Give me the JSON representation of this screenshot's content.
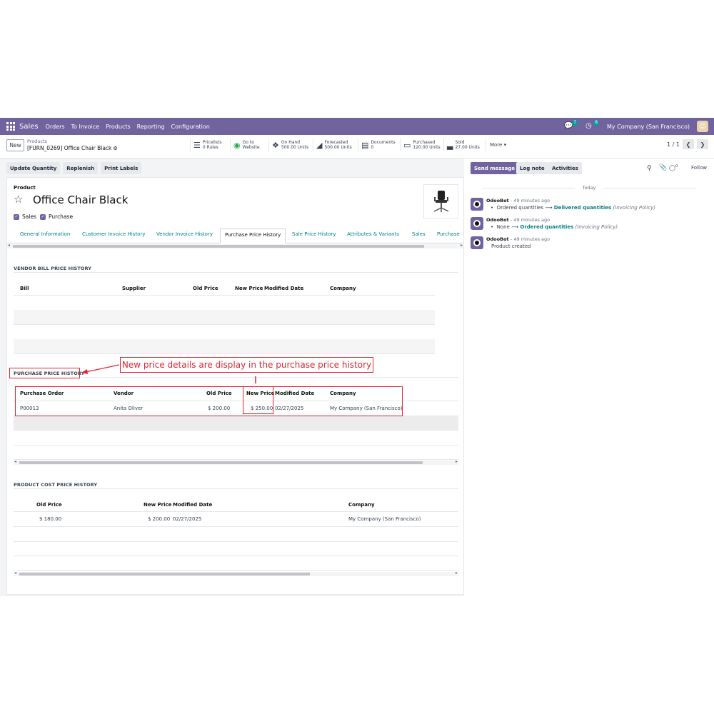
{
  "navbar": {
    "app_name": "Sales",
    "menus": [
      "Orders",
      "To Invoice",
      "Products",
      "Reporting",
      "Configuration"
    ],
    "messages_count": "7",
    "activities_count": "8",
    "company": "My Company (San Francisco)"
  },
  "control_panel": {
    "new_label": "New",
    "breadcrumb_parent": "Products",
    "breadcrumb_current": "[FURN_0269] Office Chair Black",
    "stats": {
      "pricelists": {
        "label": "Pricelists",
        "value": "0 Rules",
        "icon": "list-icon"
      },
      "website": {
        "label": "Go to",
        "value": "Website",
        "icon": "globe-icon"
      },
      "on_hand": {
        "label": "On Hand",
        "value": "500.00 Units",
        "icon": "cubes-icon"
      },
      "forecasted": {
        "label": "Forecasted",
        "value": "500.00 Units",
        "icon": "area-chart-icon"
      },
      "documents": {
        "label": "Documents",
        "value": "0",
        "icon": "document-icon"
      },
      "purchased": {
        "label": "Purchased",
        "value": "120.00 Units",
        "icon": "credit-card-icon"
      },
      "sold": {
        "label": "Sold",
        "value": "27.00 Units",
        "icon": "bar-chart-icon"
      }
    },
    "more_label": "More",
    "pager": "1 / 1"
  },
  "actions": {
    "update_quantity": "Update Quantity",
    "replenish": "Replenish",
    "print_labels": "Print Labels"
  },
  "product": {
    "label": "Product",
    "name": "Office Chair Black",
    "can_be_sold": "Sales",
    "can_be_purchased": "Purchase"
  },
  "tabs": [
    "General Information",
    "Customer Invoice History",
    "Vendor Invoice History",
    "Purchase Price History",
    "Sale Price History",
    "Attributes & Variants",
    "Sales",
    "Purchase"
  ],
  "vendor_bill_history": {
    "title": "VENDOR BILL PRICE HISTORY",
    "columns": [
      "Bill",
      "Supplier",
      "Old Price",
      "New Price",
      "Modified Date",
      "Company"
    ]
  },
  "purchase_price_history": {
    "title": "PURCHASE PRICE HISTORY",
    "columns": [
      "Purchase Order",
      "Vendor",
      "Old Price",
      "New Price",
      "Modified Date",
      "Company"
    ],
    "rows": [
      {
        "purchase_order": "P00013",
        "vendor": "Anita Oliver",
        "old_price": "$ 200.00",
        "new_price": "$ 250.00",
        "modified_date": "02/27/2025",
        "company": "My Company (San Francisco)"
      }
    ]
  },
  "product_cost_history": {
    "title": "PRODUCT COST PRICE HISTORY",
    "columns": [
      "Old Price",
      "New Price",
      "Modified Date",
      "Company"
    ],
    "rows": [
      {
        "old_price": "$ 180.00",
        "new_price": "$ 200.00",
        "modified_date": "02/27/2025",
        "company": "My Company (San Francisco)"
      }
    ]
  },
  "annotation": {
    "callout": "New price details are display in the purchase price history"
  },
  "chatter": {
    "send_message": "Send message",
    "log_note": "Log note",
    "activities": "Activities",
    "followers_count": "0",
    "follow": "Follow",
    "date_separator": "Today",
    "messages": [
      {
        "author": "OdooBot",
        "when": "- 49 minutes ago",
        "old": "Ordered quantities",
        "new": "Delivered quantities",
        "field": "(Invoicing Policy)"
      },
      {
        "author": "OdooBot",
        "when": "- 49 minutes ago",
        "old": "None",
        "new": "Ordered quantities",
        "field": "(Invoicing Policy)"
      },
      {
        "author": "OdooBot",
        "when": "- 49 minutes ago",
        "text": "Product created"
      }
    ]
  }
}
